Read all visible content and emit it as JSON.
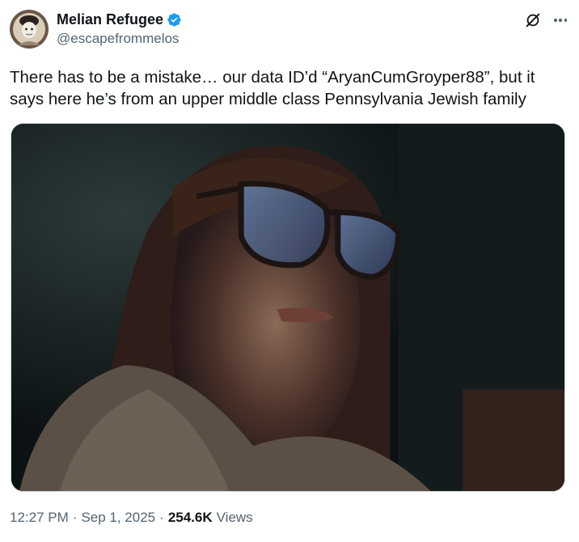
{
  "author": {
    "display_name": "Melian Refugee",
    "handle": "@escapefrommelos",
    "verified": true,
    "avatar_icon": "avatar-illustration"
  },
  "header_actions": {
    "grok_icon": "grok-icon",
    "more_icon": "more-options-icon"
  },
  "tweet": {
    "text": "There has to be a mistake… our data ID’d “AryanCumGroyper88”, but it says here he’s from an upper middle class Pennsylvania Jewish family"
  },
  "media": {
    "type": "image"
  },
  "meta": {
    "time": "12:27 PM",
    "separator": "·",
    "date": "Sep 1, 2025",
    "views_count": "254.6K",
    "views_label": "Views"
  },
  "colors": {
    "text_primary": "#0f1419",
    "text_secondary": "#536471",
    "verified_blue": "#1d9bf0",
    "border": "#cfd9de"
  }
}
